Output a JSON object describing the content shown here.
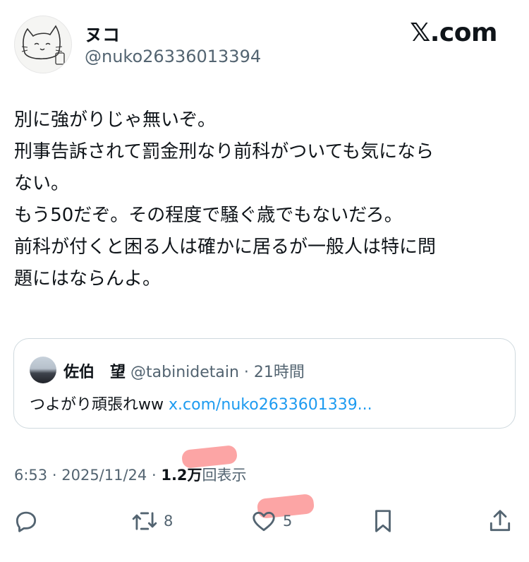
{
  "author": {
    "display_name": "ヌコ",
    "handle": "@nuko26336013394",
    "avatar_icon": "cat-drawing-avatar"
  },
  "brand": {
    "logo_text": "𝕏.com"
  },
  "tweet": {
    "lines": [
      "別に強がりじゃ無いぞ。",
      "刑事告訴されて罰金刑なり前科がついても気になら",
      "ない。",
      "もう50だぞ。その程度で騒ぐ歳でもないだろ。",
      "前科が付くと困る人は確かに居るが一般人は特に問",
      "題にはならんよ。"
    ]
  },
  "quote": {
    "name": "佐伯　望",
    "handle": "@tabinidetain",
    "separator": "·",
    "time": "21時間",
    "text": "つよがり頑張れww",
    "link": "x.com/nuko2633601339..."
  },
  "meta": {
    "time": "6:53",
    "sep1": "·",
    "date": "2025/11/24",
    "sep2": "·",
    "views": "1.2万",
    "views_suffix": "回表示"
  },
  "actions": {
    "reply": {
      "icon": "reply-icon",
      "count": ""
    },
    "retweet": {
      "icon": "retweet-icon",
      "count": "8"
    },
    "like": {
      "icon": "heart-icon",
      "count": "5"
    },
    "bookmark": {
      "icon": "bookmark-icon"
    },
    "share": {
      "icon": "share-icon"
    }
  },
  "colors": {
    "text": "#0f1419",
    "muted": "#536471",
    "link": "#1d9bf0",
    "border": "#cfd9de",
    "redaction": "#f86e6e"
  }
}
